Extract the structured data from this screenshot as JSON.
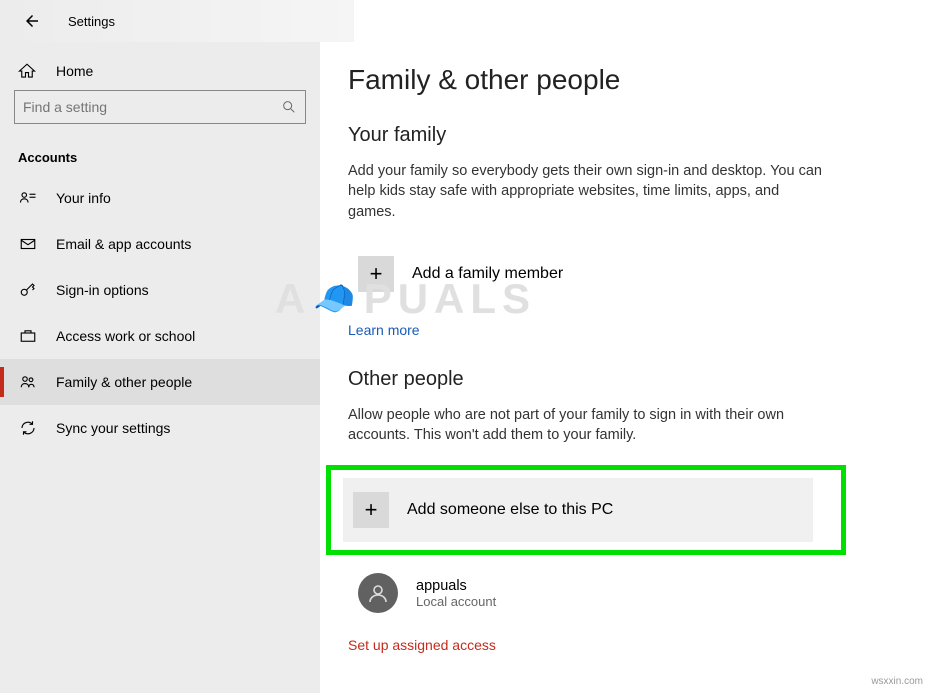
{
  "titlebar": {
    "title": "Settings"
  },
  "sidebar": {
    "home": "Home",
    "search_placeholder": "Find a setting",
    "section": "Accounts",
    "items": [
      {
        "label": "Your info"
      },
      {
        "label": "Email & app accounts"
      },
      {
        "label": "Sign-in options"
      },
      {
        "label": "Access work or school"
      },
      {
        "label": "Family & other people"
      },
      {
        "label": "Sync your settings"
      }
    ]
  },
  "main": {
    "heading": "Family & other people",
    "family": {
      "title": "Your family",
      "desc": "Add your family so everybody gets their own sign-in and desktop. You can help kids stay safe with appropriate websites, time limits, apps, and games.",
      "add_label": "Add a family member",
      "learn_more": "Learn more"
    },
    "other": {
      "title": "Other people",
      "desc": "Allow people who are not part of your family to sign in with their own accounts. This won't add them to your family.",
      "add_label": "Add someone else to this PC",
      "account": {
        "name": "appuals",
        "type": "Local account"
      },
      "assigned_link": "Set up assigned access"
    }
  },
  "watermark": {
    "left": "A",
    "right": "PUALS"
  },
  "attrib": "wsxxin.com"
}
